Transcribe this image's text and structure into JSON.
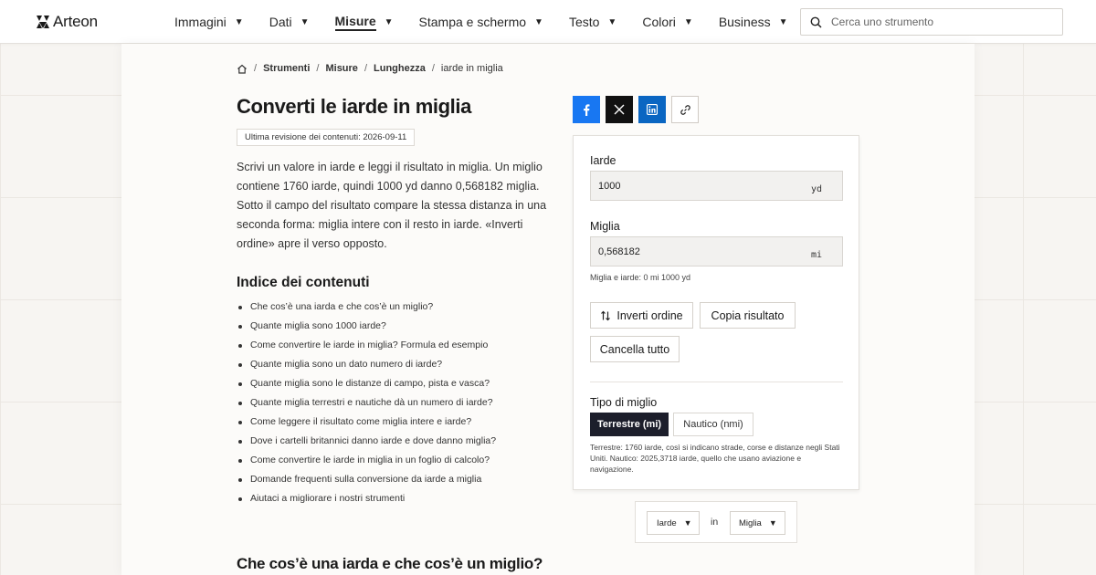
{
  "brand": {
    "name": "Arteon"
  },
  "nav": {
    "items": [
      {
        "label": "Immagini"
      },
      {
        "label": "Dati"
      },
      {
        "label": "Misure"
      },
      {
        "label": "Stampa e schermo"
      },
      {
        "label": "Testo"
      },
      {
        "label": "Colori"
      },
      {
        "label": "Business"
      }
    ],
    "active": "Misure",
    "caret": "▼"
  },
  "search": {
    "placeholder": "Cerca uno strumento",
    "icon": "search-icon"
  },
  "breadcrumb": {
    "home_icon": "home-icon",
    "items": [
      "Strumenti",
      "Misure",
      "Lunghezza"
    ],
    "current": "iarde in miglia",
    "separator": "/"
  },
  "page": {
    "title": "Converti le iarde in miglia",
    "revision": "Ultima revisione dei contenuti: 2026-09-11",
    "intro": "Scrivi un valore in iarde e leggi il risultato in miglia. Un miglio contiene 1760 iarde, quindi 1000 yd danno 0,568182 miglia. Sotto il campo del risultato compare la stessa distanza in una seconda forma: miglia intere con il resto in iarde. «Inverti ordine» apre il verso opposto.",
    "toc_title": "Indice dei contenuti",
    "toc": [
      "Che cos’è una iarda e che cos’è un miglio?",
      "Quante miglia sono 1000 iarde?",
      "Come convertire le iarde in miglia? Formula ed esempio",
      "Quante miglia sono un dato numero di iarde?",
      "Quante miglia sono le distanze di campo, pista e vasca?",
      "Quante miglia terrestri e nautiche dà un numero di iarde?",
      "Come leggere il risultato come miglia intere e iarde?",
      "Dove i cartelli britannici danno iarde e dove danno miglia?",
      "Come convertire le iarde in miglia in un foglio di calcolo?",
      "Domande frequenti sulla conversione da iarde a miglia",
      "Aiutaci a migliorare i nostri strumenti"
    ],
    "section_heading": "Che cos’è una iarda e che cos’è un miglio?"
  },
  "share": {
    "buttons": [
      {
        "name": "facebook",
        "icon": "facebook-icon",
        "color": "#1877f2"
      },
      {
        "name": "x",
        "icon": "x-icon",
        "color": "#111111"
      },
      {
        "name": "linkedin",
        "icon": "linkedin-icon",
        "color": "#0a66c2"
      },
      {
        "name": "copy-link",
        "icon": "link-icon",
        "color": "#ffffff"
      }
    ]
  },
  "converter": {
    "input_label": "Iarde",
    "input_value": "1000",
    "input_unit": "yd",
    "output_label": "Miglia",
    "output_value": "0,568182",
    "output_unit": "mi",
    "mixed_result": "Miglia e iarde: 0 mi 1000 yd",
    "swap_label": "Inverti ordine",
    "copy_label": "Copia risultato",
    "clear_label": "Cancella tutto",
    "type_label": "Tipo di miglio",
    "type_options": [
      "Terrestre (mi)",
      "Nautico (nmi)"
    ],
    "type_selected": "Terrestre (mi)",
    "type_note": "Terrestre: 1760 iarde, così si indicano strade, corse e distanze negli Stati Uniti. Nautico: 2025,3718 iarde, quello che usano aviazione e navigazione."
  },
  "unit_selector": {
    "from": "Iarde",
    "connector": "in",
    "to": "Miglia"
  },
  "colors": {
    "accent_dark": "#1c1e2b",
    "facebook": "#1877f2",
    "linkedin": "#0a66c2"
  }
}
